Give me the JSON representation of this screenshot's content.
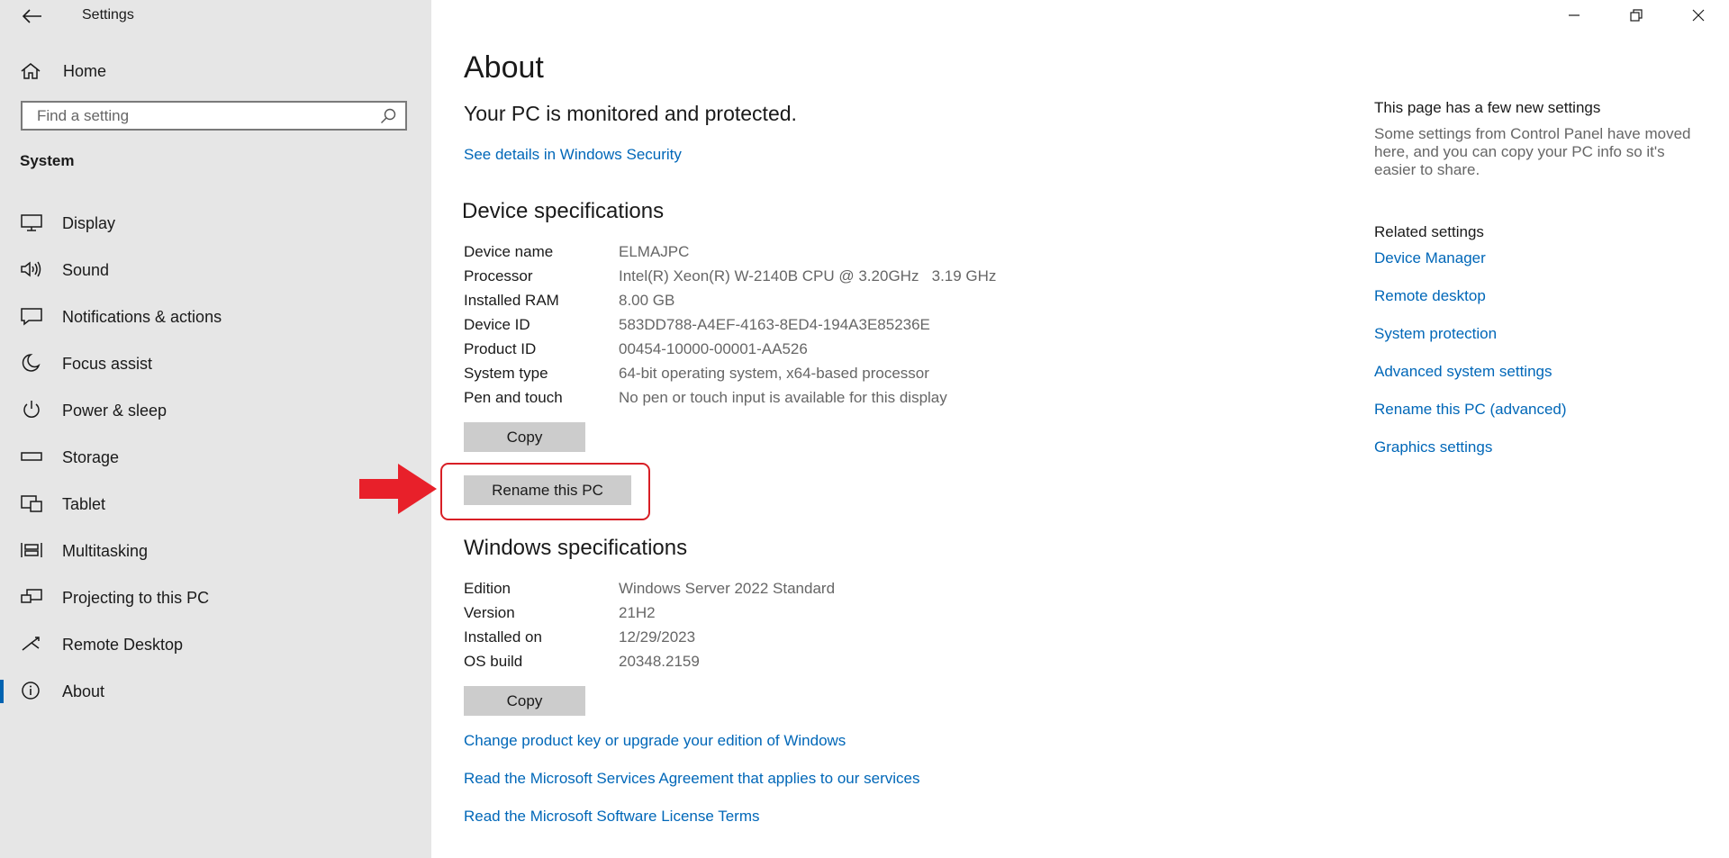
{
  "window": {
    "title": "Settings"
  },
  "sidebar": {
    "home_label": "Home",
    "search_placeholder": "Find a setting",
    "section_label": "System",
    "items": [
      {
        "label": "Display",
        "icon": "display-icon"
      },
      {
        "label": "Sound",
        "icon": "sound-icon"
      },
      {
        "label": "Notifications & actions",
        "icon": "notifications-icon"
      },
      {
        "label": "Focus assist",
        "icon": "focus-assist-icon"
      },
      {
        "label": "Power & sleep",
        "icon": "power-icon"
      },
      {
        "label": "Storage",
        "icon": "storage-icon"
      },
      {
        "label": "Tablet",
        "icon": "tablet-icon"
      },
      {
        "label": "Multitasking",
        "icon": "multitasking-icon"
      },
      {
        "label": "Projecting to this PC",
        "icon": "projecting-icon"
      },
      {
        "label": "Remote Desktop",
        "icon": "remote-desktop-icon"
      },
      {
        "label": "About",
        "icon": "info-icon",
        "active": true
      }
    ]
  },
  "main": {
    "title": "About",
    "protection_status": "Your PC is monitored and protected.",
    "security_link": "See details in Windows Security",
    "device_specs": {
      "heading": "Device specifications",
      "rows": [
        {
          "key": "Device name",
          "value": "ELMAJPC"
        },
        {
          "key": "Processor",
          "value": "Intel(R) Xeon(R) W-2140B CPU @ 3.20GHz   3.19 GHz"
        },
        {
          "key": "Installed RAM",
          "value": "8.00 GB"
        },
        {
          "key": "Device ID",
          "value": "583DD788-A4EF-4163-8ED4-194A3E85236E"
        },
        {
          "key": "Product ID",
          "value": "00454-10000-00001-AA526"
        },
        {
          "key": "System type",
          "value": "64-bit operating system, x64-based processor"
        },
        {
          "key": "Pen and touch",
          "value": "No pen or touch input is available for this display"
        }
      ],
      "copy_label": "Copy",
      "rename_label": "Rename this PC"
    },
    "windows_specs": {
      "heading": "Windows specifications",
      "rows": [
        {
          "key": "Edition",
          "value": "Windows Server 2022 Standard"
        },
        {
          "key": "Version",
          "value": "21H2"
        },
        {
          "key": "Installed on",
          "value": "12/29/2023"
        },
        {
          "key": "OS build",
          "value": "20348.2159"
        }
      ],
      "copy_label": "Copy"
    },
    "bottom_links": [
      "Change product key or upgrade your edition of Windows",
      "Read the Microsoft Services Agreement that applies to our services",
      "Read the Microsoft Software License Terms"
    ]
  },
  "right_panel": {
    "notice_title": "This page has a few new settings",
    "notice_desc": "Some settings from Control Panel have moved here, and you can copy your PC info so it's easier to share.",
    "related_title": "Related settings",
    "related_links": [
      "Device Manager",
      "Remote desktop",
      "System protection",
      "Advanced system settings",
      "Rename this PC (advanced)",
      "Graphics settings"
    ]
  },
  "colors": {
    "accent": "#0067b8",
    "sidebar_bg": "#e6e6e6",
    "button_bg": "#cccccc",
    "highlight": "#d81f26"
  }
}
